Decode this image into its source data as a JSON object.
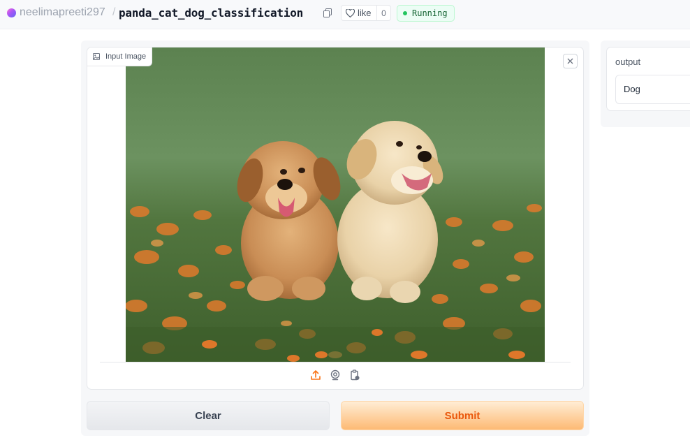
{
  "header": {
    "owner": "neelimapreeti297",
    "separator": "/",
    "repo": "panda_cat_dog_classification",
    "like_label": "like",
    "like_count": "0",
    "status": "Running"
  },
  "input": {
    "label": "Input Image",
    "image_description": "Two golden retriever puppies sitting on grass with orange flowers"
  },
  "buttons": {
    "clear": "Clear",
    "submit": "Submit"
  },
  "output": {
    "label": "output",
    "value": "Dog"
  },
  "colors": {
    "accent": "#ea580c",
    "status_green": "#22c55e"
  }
}
